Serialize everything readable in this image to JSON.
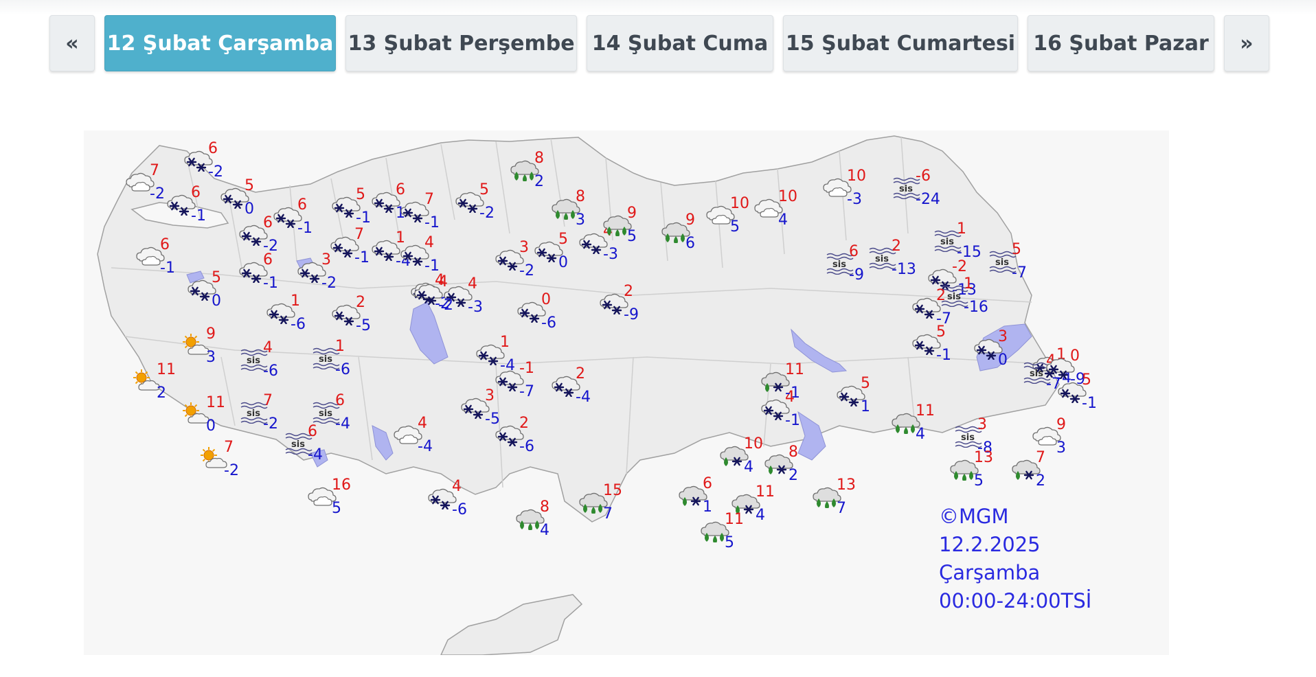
{
  "nav": {
    "prev_label": "«",
    "next_label": "»",
    "tabs": [
      {
        "label": "12 Şubat Çarşamba",
        "active": true
      },
      {
        "label": "13 Şubat Perşembe",
        "active": false
      },
      {
        "label": "14 Şubat Cuma",
        "active": false
      },
      {
        "label": "15 Şubat Cumartesi",
        "active": false
      },
      {
        "label": "16 Şubat Pazar",
        "active": false
      }
    ]
  },
  "map": {
    "credits": {
      "copyright": "©MGM",
      "date": "12.2.2025",
      "day": "Çarşamba",
      "period": "00:00-24:00TSİ"
    },
    "colors": {
      "max_temp": "#e01818",
      "min_temp": "#1515cc",
      "land": "#ececec",
      "water": "#b0b4f0",
      "border": "#a0a0a0",
      "rain_drop": "#2f8a2f",
      "sun": "#f2a000"
    },
    "fog_label": "sis",
    "stations": [
      {
        "icon": "snow-cloud-icon",
        "max": "6",
        "min": "-2"
      },
      {
        "icon": "cloudy-icon",
        "max": "7",
        "min": "-2"
      },
      {
        "icon": "snow-cloud-icon",
        "max": "6",
        "min": "-1"
      },
      {
        "icon": "snow-cloud-icon",
        "max": "5",
        "min": "0"
      },
      {
        "icon": "snow-cloud-icon",
        "max": "6",
        "min": "-1"
      },
      {
        "icon": "snow-cloud-icon",
        "max": "6",
        "min": "-2"
      },
      {
        "icon": "cloudy-icon",
        "max": "6",
        "min": "-1"
      },
      {
        "icon": "snow-cloud-icon",
        "max": "6",
        "min": "-1"
      },
      {
        "icon": "snow-cloud-icon",
        "max": "3",
        "min": "-2"
      },
      {
        "icon": "snow-cloud-icon",
        "max": "5",
        "min": "0"
      },
      {
        "icon": "snow-cloud-icon",
        "max": "1",
        "min": "-6"
      },
      {
        "icon": "partly-sunny-icon",
        "max": "9",
        "min": "3"
      },
      {
        "icon": "partly-sunny-icon",
        "max": "11",
        "min": "2"
      },
      {
        "icon": "partly-sunny-icon",
        "max": "11",
        "min": "0"
      },
      {
        "icon": "partly-sunny-icon",
        "max": "7",
        "min": "-2"
      },
      {
        "icon": "fog-icon",
        "max": "4",
        "min": "-6"
      },
      {
        "icon": "fog-icon",
        "max": "7",
        "min": "-2"
      },
      {
        "icon": "fog-icon",
        "max": "6",
        "min": "-4"
      },
      {
        "icon": "fog-icon",
        "max": "1",
        "min": "-6"
      },
      {
        "icon": "fog-icon",
        "max": "6",
        "min": "-4"
      },
      {
        "icon": "cloudy-icon",
        "max": "16",
        "min": "5"
      },
      {
        "icon": "snow-cloud-icon",
        "max": "5",
        "min": "-1"
      },
      {
        "icon": "snow-cloud-icon",
        "max": "6",
        "min": "1"
      },
      {
        "icon": "snow-cloud-icon",
        "max": "7",
        "min": "-1"
      },
      {
        "icon": "snow-cloud-icon",
        "max": "1",
        "min": "-4"
      },
      {
        "icon": "snow-cloud-icon",
        "max": "2",
        "min": "-5"
      },
      {
        "icon": "snow-cloud-icon",
        "max": "7",
        "min": "-1"
      },
      {
        "icon": "snow-cloud-icon",
        "max": "5",
        "min": "-2"
      },
      {
        "icon": "snow-cloud-icon",
        "max": "4",
        "min": "-1"
      },
      {
        "icon": "snow-cloud-icon",
        "max": "4",
        "min": "-2"
      },
      {
        "icon": "snow-cloud-icon",
        "max": "3",
        "min": "-2"
      },
      {
        "icon": "snow-cloud-icon",
        "max": "4",
        "min": "-3"
      },
      {
        "icon": "snow-cloud-icon",
        "max": "4",
        "min": "-3"
      },
      {
        "icon": "snow-cloud-icon",
        "max": "5",
        "min": "0"
      },
      {
        "icon": "snow-cloud-icon",
        "max": "4",
        "min": "-2"
      },
      {
        "icon": "snow-cloud-icon",
        "max": "0",
        "min": "-6"
      },
      {
        "icon": "snow-cloud-icon",
        "max": "2",
        "min": "-9"
      },
      {
        "icon": "snow-cloud-icon",
        "max": "1",
        "min": "-4"
      },
      {
        "icon": "snow-cloud-icon",
        "max": "-1",
        "min": "-7"
      },
      {
        "icon": "snow-cloud-icon",
        "max": "2",
        "min": "-4"
      },
      {
        "icon": "snow-cloud-icon",
        "max": "3",
        "min": "-5"
      },
      {
        "icon": "snow-cloud-icon",
        "max": "2",
        "min": "-6"
      },
      {
        "icon": "cloudy-icon",
        "max": "4",
        "min": "-4"
      },
      {
        "icon": "snow-cloud-icon",
        "max": "4",
        "min": "-6"
      },
      {
        "icon": "rain-cloud-icon",
        "max": "8",
        "min": "2"
      },
      {
        "icon": "rain-cloud-icon",
        "max": "8",
        "min": "3"
      },
      {
        "icon": "rain-cloud-icon",
        "max": "9",
        "min": "5"
      },
      {
        "icon": "rain-cloud-icon",
        "max": "9",
        "min": "6"
      },
      {
        "icon": "cloudy-icon",
        "max": "10",
        "min": "5"
      },
      {
        "icon": "cloudy-icon",
        "max": "10",
        "min": "4"
      },
      {
        "icon": "cloudy-icon",
        "max": "10",
        "min": "-3"
      },
      {
        "icon": "fog-icon",
        "max": "-6",
        "min": "-24"
      },
      {
        "icon": "fog-icon",
        "max": "6",
        "min": "-9"
      },
      {
        "icon": "fog-icon",
        "max": "2",
        "min": "-13"
      },
      {
        "icon": "fog-icon",
        "max": "1",
        "min": "-15"
      },
      {
        "icon": "fog-icon",
        "max": "5",
        "min": "-7"
      },
      {
        "icon": "snow-cloud-icon",
        "max": "-2",
        "min": "-13"
      },
      {
        "icon": "fog-icon",
        "max": "1",
        "min": "-16"
      },
      {
        "icon": "snow-cloud-icon",
        "max": "2",
        "min": "-7"
      },
      {
        "icon": "snow-cloud-icon",
        "max": "5",
        "min": "-1"
      },
      {
        "icon": "snow-cloud-icon",
        "max": "3",
        "min": "0"
      },
      {
        "icon": "snow-cloud-icon",
        "max": "1",
        "min": "-4"
      },
      {
        "icon": "fog-icon",
        "max": "4",
        "min": "-7"
      },
      {
        "icon": "snow-cloud-icon",
        "max": "0",
        "min": "-9"
      },
      {
        "icon": "snow-cloud-icon",
        "max": "5",
        "min": "-1"
      },
      {
        "icon": "snow-cloud-icon",
        "max": "5",
        "min": "1"
      },
      {
        "icon": "snow-cloud-icon",
        "max": "4",
        "min": "-1"
      },
      {
        "icon": "rain-snow-icon",
        "max": "11",
        "min": "-1"
      },
      {
        "icon": "rain-cloud-icon",
        "max": "11",
        "min": "4"
      },
      {
        "icon": "fog-icon",
        "max": "3",
        "min": "-8"
      },
      {
        "icon": "cloudy-icon",
        "max": "9",
        "min": "3"
      },
      {
        "icon": "rain-snow-icon",
        "max": "7",
        "min": "2"
      },
      {
        "icon": "rain-snow-icon",
        "max": "10",
        "min": "4"
      },
      {
        "icon": "rain-snow-icon",
        "max": "8",
        "min": "2"
      },
      {
        "icon": "rain-cloud-icon",
        "max": "13",
        "min": "5"
      },
      {
        "icon": "rain-snow-icon",
        "max": "6",
        "min": "1"
      },
      {
        "icon": "rain-snow-icon",
        "max": "11",
        "min": "4"
      },
      {
        "icon": "rain-cloud-icon",
        "max": "13",
        "min": "7"
      },
      {
        "icon": "rain-cloud-icon",
        "max": "15",
        "min": "7"
      },
      {
        "icon": "rain-cloud-icon",
        "max": "8",
        "min": "4"
      },
      {
        "icon": "rain-cloud-icon",
        "max": "11",
        "min": "5"
      }
    ]
  }
}
